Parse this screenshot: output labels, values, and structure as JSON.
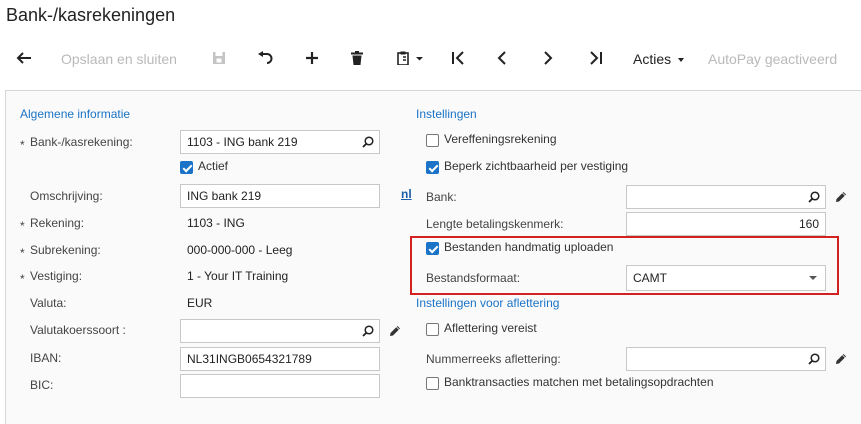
{
  "page": {
    "title": "Bank-/kasrekeningen"
  },
  "toolbar": {
    "back_icon": "arrow-left-icon",
    "save_close_label": "Opslaan en sluiten",
    "save_icon": "floppy-disk-icon",
    "undo_icon": "undo-icon",
    "add_icon": "plus-icon",
    "delete_icon": "trash-icon",
    "paste_icon": "clipboard-icon",
    "first_icon": "first-record-icon",
    "prev_icon": "chevron-left-icon",
    "next_icon": "chevron-right-icon",
    "last_icon": "last-record-icon",
    "actions_label": "Acties",
    "autopay_label": "AutoPay geactiveerd"
  },
  "general": {
    "section_title": "Algemene informatie",
    "cash_account_label": "Bank-/kasrekening:",
    "cash_account_value": "1103 - ING bank 219",
    "active_label": "Actief",
    "active_checked": true,
    "description_label": "Omschrijving:",
    "description_value": "ING bank 219",
    "lang_label": "nl",
    "account_label": "Rekening:",
    "account_value": "1103 - ING",
    "subaccount_label": "Subrekening:",
    "subaccount_value": "000-000-000 - Leeg",
    "branch_label": "Vestiging:",
    "branch_value": "1 - Your IT Training",
    "currency_label": "Valuta:",
    "currency_value": "EUR",
    "rate_type_label": "Valutakoerssoort :",
    "rate_type_value": "",
    "iban_label": "IBAN:",
    "iban_value": "NL31INGB0654321789",
    "bic_label": "BIC:",
    "bic_value": "",
    "required_mark": "*"
  },
  "settings": {
    "section_title": "Instellingen",
    "clearing_label": "Vereffeningsrekening",
    "clearing_checked": false,
    "restrict_label": "Beperk zichtbaarheid per vestiging",
    "restrict_checked": true,
    "bank_label": "Bank:",
    "bank_value": "",
    "ref_length_label": "Lengte betalingskenmerk:",
    "ref_length_value": "160",
    "manual_upload_label": "Bestanden handmatig uploaden",
    "manual_upload_checked": true,
    "file_format_label": "Bestandsformaat:",
    "file_format_value": "CAMT"
  },
  "matching": {
    "section_title": "Instellingen voor aflettering",
    "required_label": "Aflettering vereist",
    "required_checked": false,
    "numbering_label": "Nummerreeks aflettering:",
    "numbering_value": "",
    "match_label": "Banktransacties matchen met betalingsopdrachten",
    "match_checked": false
  },
  "colors": {
    "accent": "#1a73c7",
    "highlight": "#d32121"
  }
}
